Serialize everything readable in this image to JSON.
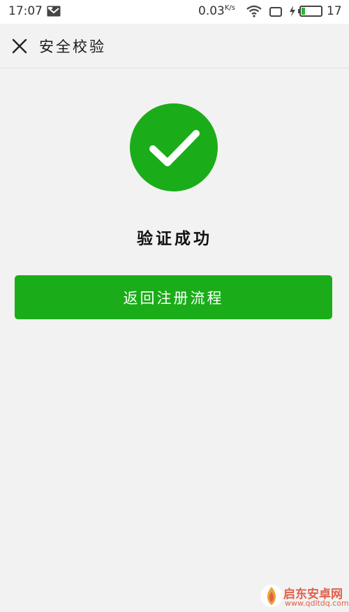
{
  "status_bar": {
    "time": "17:07",
    "network_speed": "0.03",
    "network_unit": "K/s",
    "battery_level": "17",
    "battery_fraction": 0.17,
    "icons": [
      "message-icon",
      "wifi-icon",
      "screen-icon",
      "charging-icon",
      "battery-icon"
    ]
  },
  "header": {
    "title": "安全校验",
    "close_icon": "close-icon"
  },
  "main": {
    "success_icon": "check-circle-icon",
    "success_message": "验证成功",
    "return_button_label": "返回注册流程"
  },
  "colors": {
    "accent": "#1aad19",
    "background": "#f2f2f2",
    "status_bar": "#ffffff"
  },
  "watermark": {
    "title": "启东安卓网",
    "url": "www.qdltdq.com"
  }
}
